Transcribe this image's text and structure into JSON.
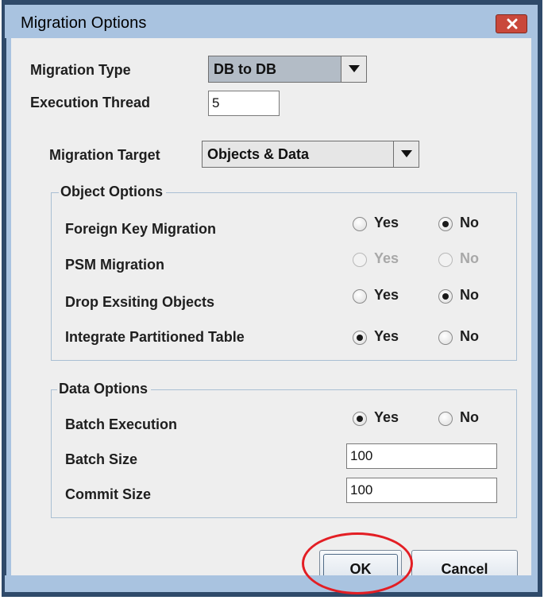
{
  "window": {
    "title": "Migration Options"
  },
  "migration_type": {
    "label": "Migration Type",
    "value": "DB to DB"
  },
  "execution_thread": {
    "label": "Execution Thread",
    "value": "5"
  },
  "migration_target": {
    "label": "Migration Target",
    "value": "Objects & Data"
  },
  "object_options": {
    "title": "Object Options",
    "rows": [
      {
        "label": "Foreign Key Migration",
        "yes": "Yes",
        "no": "No",
        "selected": "no",
        "enabled": true
      },
      {
        "label": "PSM Migration",
        "yes": "Yes",
        "no": "No",
        "selected": "none",
        "enabled": false
      },
      {
        "label": "Drop Exsiting Objects",
        "yes": "Yes",
        "no": "No",
        "selected": "no",
        "enabled": true
      },
      {
        "label": "Integrate Partitioned Table",
        "yes": "Yes",
        "no": "No",
        "selected": "yes",
        "enabled": true
      }
    ]
  },
  "data_options": {
    "title": "Data Options",
    "batch_execution": {
      "label": "Batch Execution",
      "yes": "Yes",
      "no": "No",
      "selected": "yes"
    },
    "batch_size": {
      "label": "Batch Size",
      "value": "100"
    },
    "commit_size": {
      "label": "Commit Size",
      "value": "100"
    }
  },
  "buttons": {
    "ok": "OK",
    "cancel": "Cancel"
  },
  "colors": {
    "title_bar": "#a9c3e0",
    "close_button": "#c9483b",
    "highlight_circle": "#e31e24"
  }
}
